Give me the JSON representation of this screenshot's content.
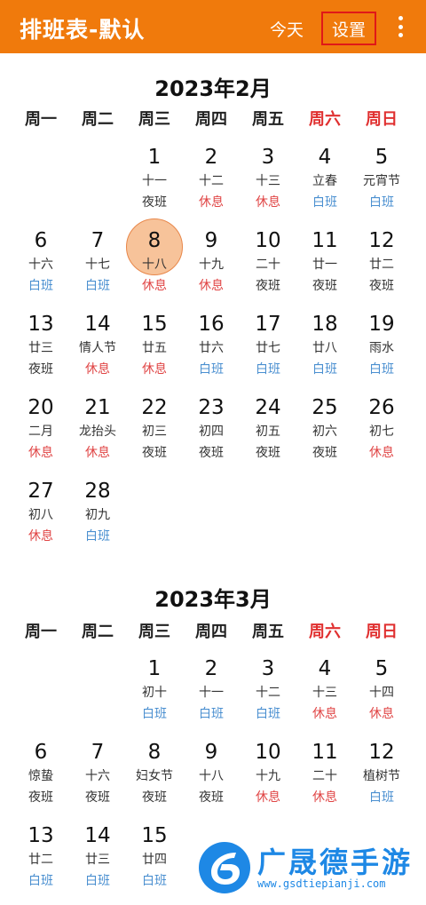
{
  "appbar": {
    "title": "排班表-默认",
    "today_label": "今天",
    "settings_label": "设置",
    "more_icon": "more-vertical-icon",
    "bg_color": "#f07a0c"
  },
  "weekdays": [
    "周一",
    "周二",
    "周三",
    "周四",
    "周五",
    "周六",
    "周日"
  ],
  "months": [
    {
      "title": "2023年2月",
      "days": [
        {
          "n": "1",
          "l": "十一",
          "s": "夜班",
          "t": "night"
        },
        {
          "n": "2",
          "l": "十二",
          "s": "休息",
          "t": "rest"
        },
        {
          "n": "3",
          "l": "十三",
          "s": "休息",
          "t": "rest"
        },
        {
          "n": "4",
          "l": "立春",
          "s": "白班",
          "t": "day"
        },
        {
          "n": "5",
          "l": "元宵节",
          "s": "白班",
          "t": "day"
        },
        {
          "n": "6",
          "l": "十六",
          "s": "白班",
          "t": "day"
        },
        {
          "n": "7",
          "l": "十七",
          "s": "白班",
          "t": "day"
        },
        {
          "n": "8",
          "l": "十八",
          "s": "休息",
          "t": "rest",
          "today": true
        },
        {
          "n": "9",
          "l": "十九",
          "s": "休息",
          "t": "rest"
        },
        {
          "n": "10",
          "l": "二十",
          "s": "夜班",
          "t": "night"
        },
        {
          "n": "11",
          "l": "廿一",
          "s": "夜班",
          "t": "night"
        },
        {
          "n": "12",
          "l": "廿二",
          "s": "夜班",
          "t": "night"
        },
        {
          "n": "13",
          "l": "廿三",
          "s": "夜班",
          "t": "night"
        },
        {
          "n": "14",
          "l": "情人节",
          "s": "休息",
          "t": "rest"
        },
        {
          "n": "15",
          "l": "廿五",
          "s": "休息",
          "t": "rest"
        },
        {
          "n": "16",
          "l": "廿六",
          "s": "白班",
          "t": "day"
        },
        {
          "n": "17",
          "l": "廿七",
          "s": "白班",
          "t": "day"
        },
        {
          "n": "18",
          "l": "廿八",
          "s": "白班",
          "t": "day"
        },
        {
          "n": "19",
          "l": "雨水",
          "s": "白班",
          "t": "day"
        },
        {
          "n": "20",
          "l": "二月",
          "s": "休息",
          "t": "rest"
        },
        {
          "n": "21",
          "l": "龙抬头",
          "s": "休息",
          "t": "rest"
        },
        {
          "n": "22",
          "l": "初三",
          "s": "夜班",
          "t": "night"
        },
        {
          "n": "23",
          "l": "初四",
          "s": "夜班",
          "t": "night"
        },
        {
          "n": "24",
          "l": "初五",
          "s": "夜班",
          "t": "night"
        },
        {
          "n": "25",
          "l": "初六",
          "s": "夜班",
          "t": "night"
        },
        {
          "n": "26",
          "l": "初七",
          "s": "休息",
          "t": "rest"
        },
        {
          "n": "27",
          "l": "初八",
          "s": "休息",
          "t": "rest"
        },
        {
          "n": "28",
          "l": "初九",
          "s": "白班",
          "t": "day"
        }
      ]
    },
    {
      "title": "2023年3月",
      "days": [
        {
          "n": "1",
          "l": "初十",
          "s": "白班",
          "t": "day"
        },
        {
          "n": "2",
          "l": "十一",
          "s": "白班",
          "t": "day"
        },
        {
          "n": "3",
          "l": "十二",
          "s": "白班",
          "t": "day"
        },
        {
          "n": "4",
          "l": "十三",
          "s": "休息",
          "t": "rest"
        },
        {
          "n": "5",
          "l": "十四",
          "s": "休息",
          "t": "rest"
        },
        {
          "n": "6",
          "l": "惊蛰",
          "s": "夜班",
          "t": "night"
        },
        {
          "n": "7",
          "l": "十六",
          "s": "夜班",
          "t": "night"
        },
        {
          "n": "8",
          "l": "妇女节",
          "s": "夜班",
          "t": "night"
        },
        {
          "n": "9",
          "l": "十八",
          "s": "夜班",
          "t": "night"
        },
        {
          "n": "10",
          "l": "十九",
          "s": "休息",
          "t": "rest"
        },
        {
          "n": "11",
          "l": "二十",
          "s": "休息",
          "t": "rest"
        },
        {
          "n": "12",
          "l": "植树节",
          "s": "白班",
          "t": "day"
        },
        {
          "n": "13",
          "l": "廿二",
          "s": "白班",
          "t": "day"
        },
        {
          "n": "14",
          "l": "廿三",
          "s": "白班",
          "t": "day"
        },
        {
          "n": "15",
          "l": "廿四",
          "s": "白班",
          "t": "day"
        }
      ]
    }
  ],
  "watermark": {
    "text": "广晟德手游",
    "url": "www.gsdtiepianji.com"
  }
}
